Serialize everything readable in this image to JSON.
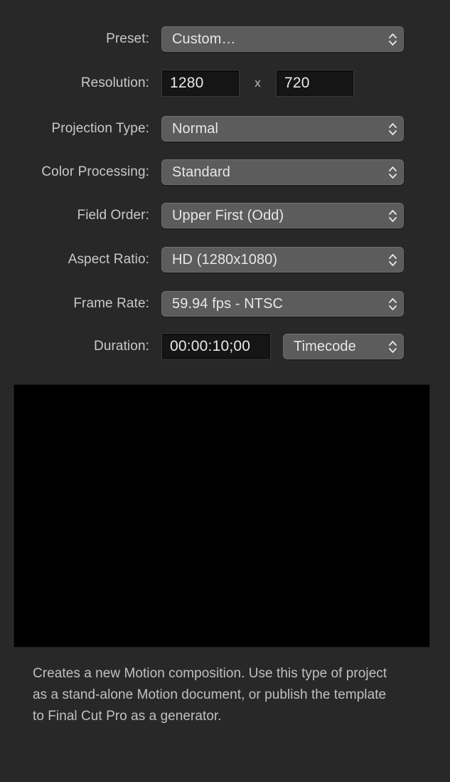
{
  "form": {
    "rows": [
      {
        "label": "Preset:",
        "control": "popup",
        "value": "Custom…"
      },
      {
        "label": "Resolution:",
        "control": "resolution",
        "width_value": "1280",
        "separator": "x",
        "height_value": "720"
      },
      {
        "label": "Projection Type:",
        "control": "popup",
        "value": "Normal"
      },
      {
        "label": "Color Processing:",
        "control": "popup",
        "value": "Standard"
      },
      {
        "label": "Field Order:",
        "control": "popup",
        "value": "Upper First (Odd)"
      },
      {
        "label": "Aspect Ratio:",
        "control": "popup",
        "value": "HD (1280x1080)"
      },
      {
        "label": "Frame Rate:",
        "control": "popup",
        "value": "59.94 fps - NTSC"
      },
      {
        "label": "Duration:",
        "control": "duration",
        "value": "00:00:10;00",
        "format_value": "Timecode"
      }
    ]
  },
  "preview": {
    "name": "composition-preview",
    "background_color": "#000000"
  },
  "description": {
    "text": "Creates a new Motion composition. Use this type of project as a stand-alone Motion document, or publish the template to Final Cut Pro as a generator."
  },
  "colors": {
    "panel_background": "#282828",
    "popup_fill": "#5c5c5c",
    "field_fill": "#151515",
    "label_text": "#c9c9c9",
    "value_text": "#e6e6e6"
  }
}
